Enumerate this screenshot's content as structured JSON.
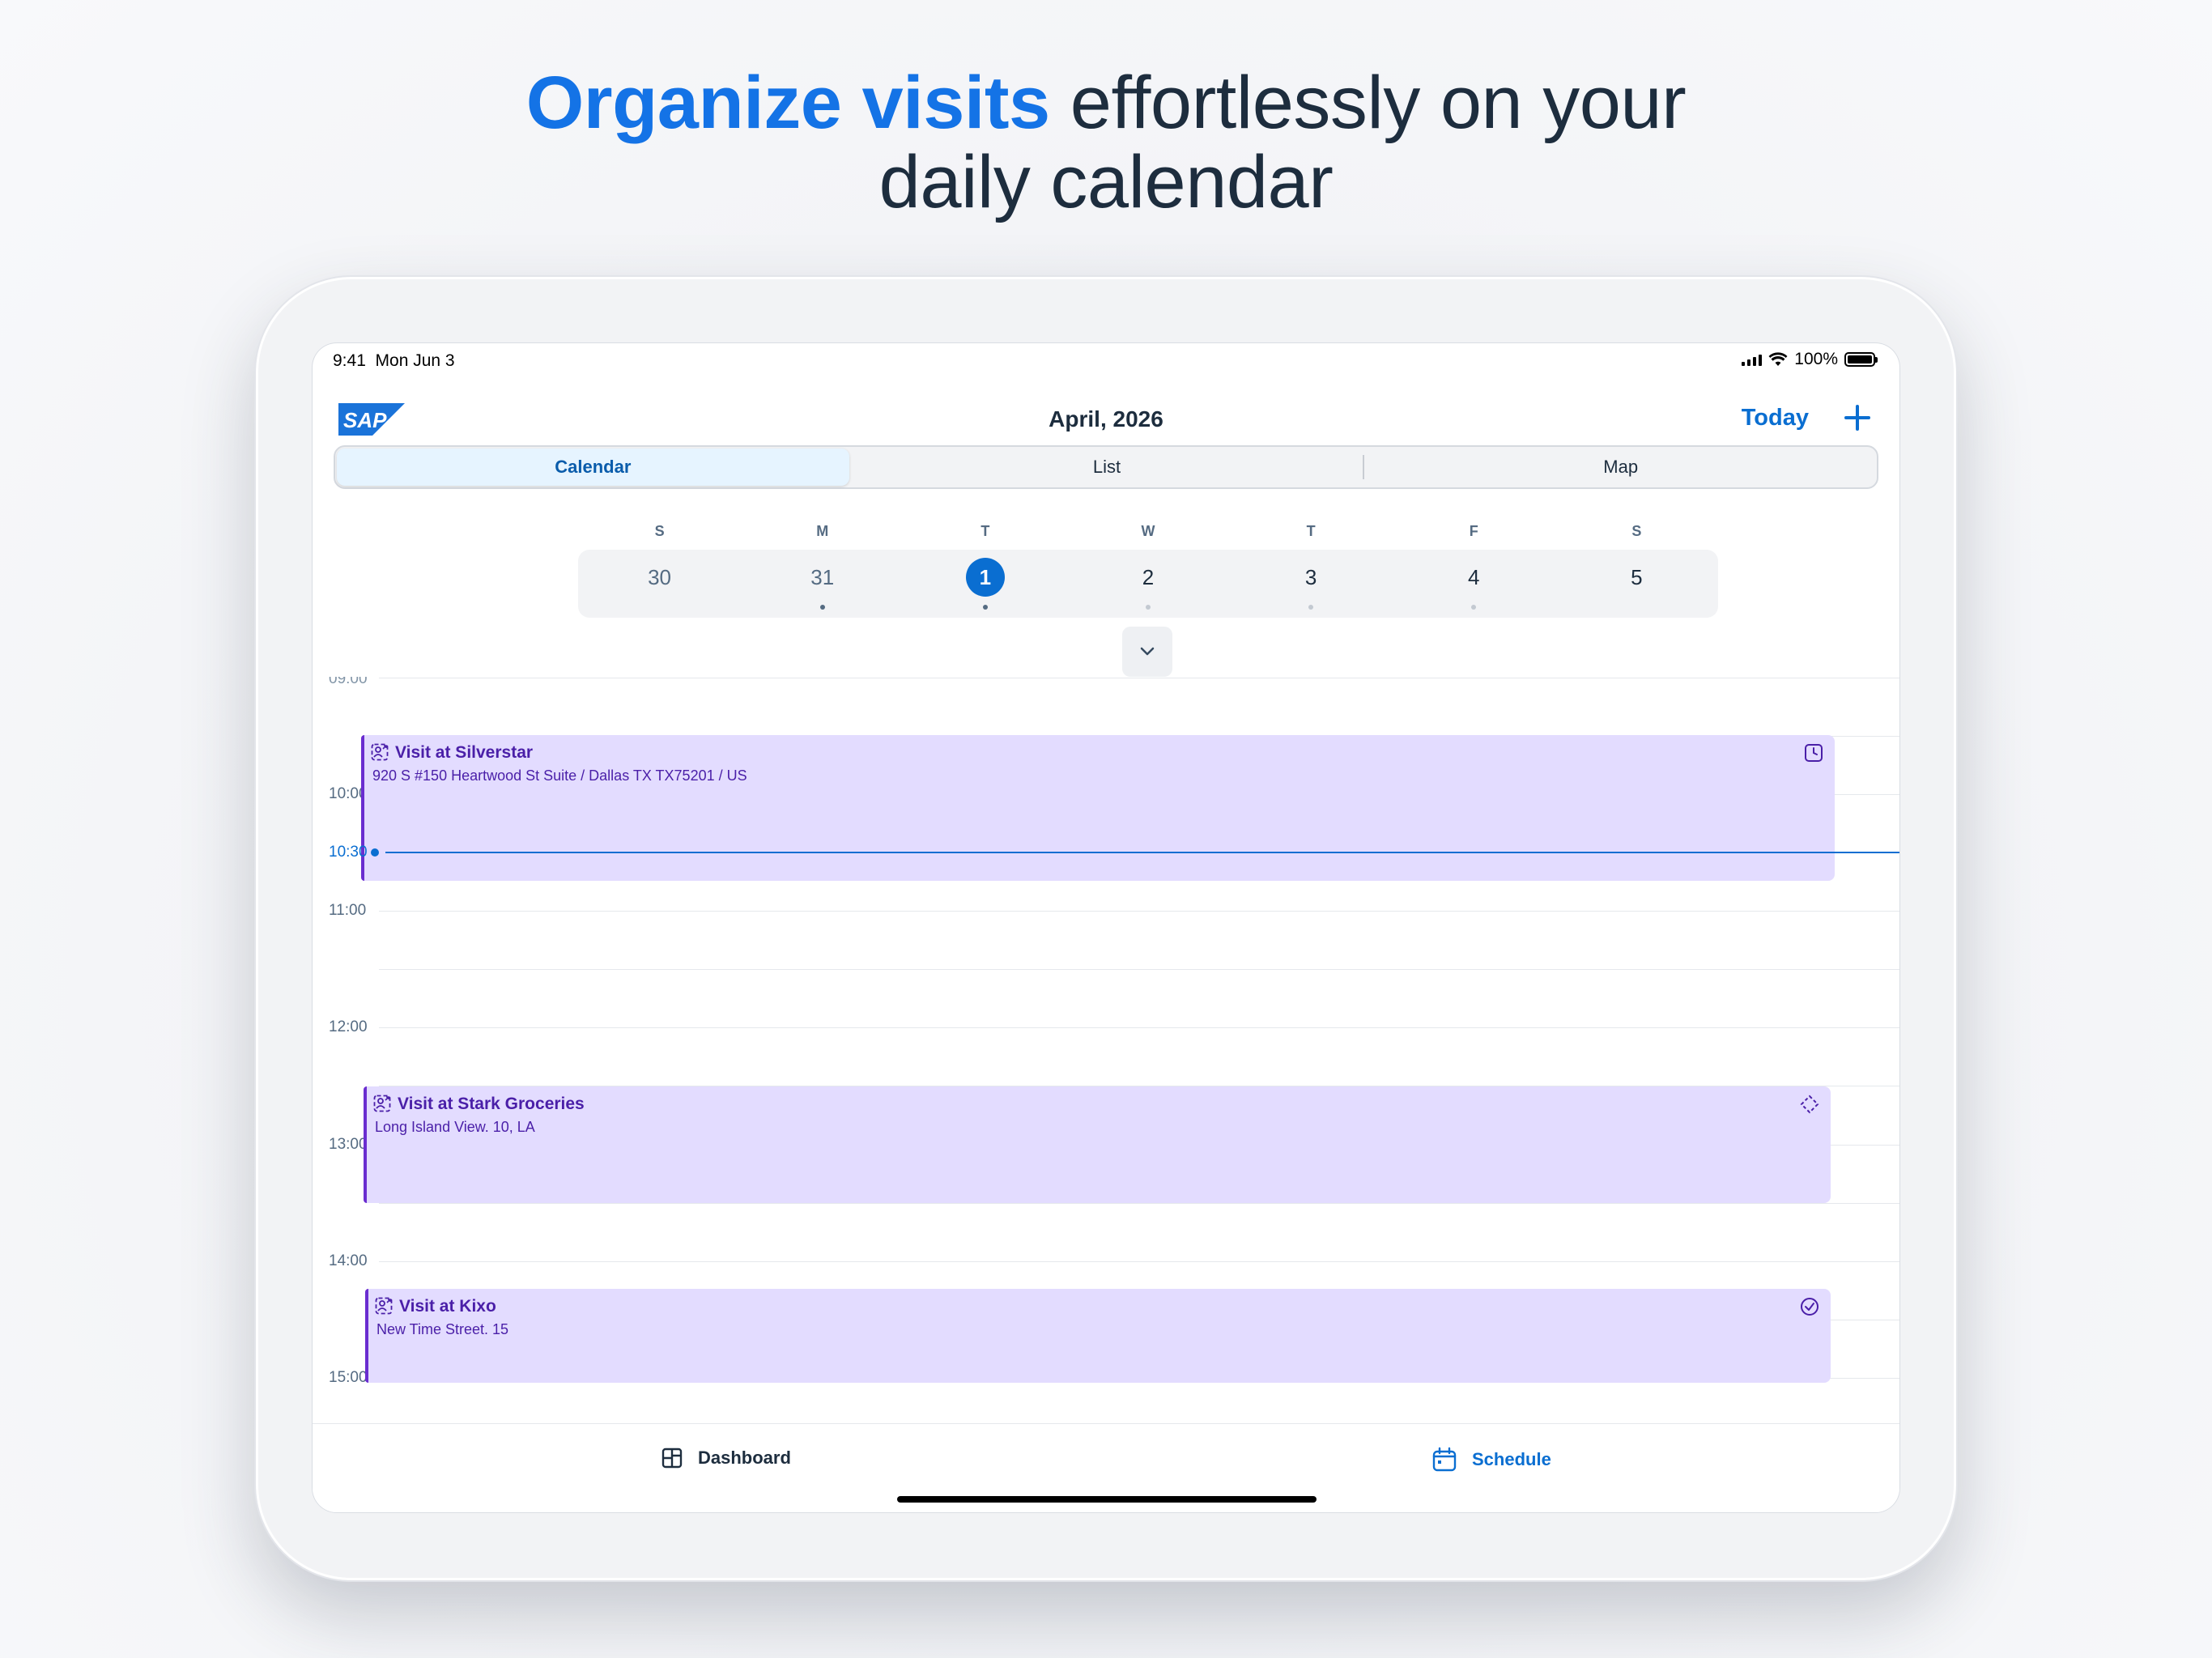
{
  "headline": {
    "accent": "Organize visits",
    "rest_line1": "effortlessly on your",
    "line2": "daily calendar"
  },
  "status_bar": {
    "time": "9:41",
    "date": "Mon Jun 3",
    "battery": "100%"
  },
  "nav": {
    "logo_text": "SAP",
    "title": "April, 2026",
    "today_label": "Today"
  },
  "segments": [
    {
      "label": "Calendar",
      "active": true
    },
    {
      "label": "List",
      "active": false
    },
    {
      "label": "Map",
      "active": false
    }
  ],
  "week": {
    "days": [
      "S",
      "M",
      "T",
      "W",
      "T",
      "F",
      "S"
    ],
    "dates": [
      "30",
      "31",
      "1",
      "2",
      "3",
      "4",
      "5"
    ],
    "selected": "1"
  },
  "timeline": {
    "hours": [
      "09:00",
      "10:00",
      "11:00",
      "12:00",
      "13:00",
      "14:00",
      "15:00"
    ],
    "now_label": "10:30"
  },
  "events": [
    {
      "title": "Visit at Silverstar",
      "address": "920 S #150 Heartwood St Suite / Dallas TX TX75201 / US",
      "status_icon": "clock-icon"
    },
    {
      "title": "Visit at Stark Groceries",
      "address": "Long Island View. 10, LA",
      "status_icon": "diamond-dots-icon"
    },
    {
      "title": "Visit at Kixo",
      "address": "New Time Street. 15",
      "status_icon": "check-circle-icon"
    }
  ],
  "tabs": {
    "dashboard": "Dashboard",
    "schedule": "Schedule"
  },
  "colors": {
    "accent": "#0a6ed1",
    "event_bg": "#e3dcff",
    "event_text": "#4a1fa8"
  }
}
